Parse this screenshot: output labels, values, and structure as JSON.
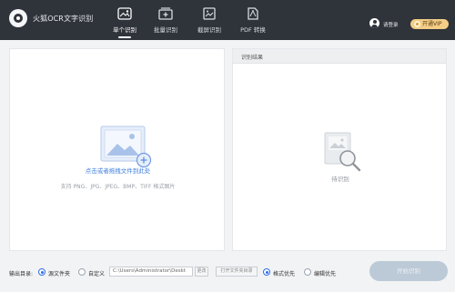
{
  "header": {
    "app_title": "火狐OCR文字识别",
    "tabs": [
      {
        "label": "单个识别",
        "icon": "image-scan-icon",
        "active": true
      },
      {
        "label": "批量识别",
        "icon": "batch-add-icon",
        "active": false
      },
      {
        "label": "截屏识别",
        "icon": "screenshot-icon",
        "active": false
      },
      {
        "label": "PDF 转换",
        "icon": "pdf-icon",
        "active": false
      }
    ],
    "login": "请登录",
    "vip_button": "开通VIP"
  },
  "upload": {
    "hint": "点击或者拖拽文件到此处",
    "formats": "支持 PNG、JPG、JPEG、BMP、TIFF 格式图片"
  },
  "result": {
    "title": "识别结果",
    "waiting": "待识别"
  },
  "bottom": {
    "output_label": "输出目录:",
    "option_source": "源文件夹",
    "option_custom": "自定义",
    "path_value": "C:\\Users\\Administrator\\Deskt",
    "change_button": "更改",
    "open_folder_button": "打开文件夹目录",
    "format_priority": "格式优先",
    "edit_priority": "编辑优先",
    "start_button": "开始识别"
  },
  "colors": {
    "header_bg": "#2f333a",
    "accent": "#2f6fe6",
    "vip": "#f3cd86",
    "start_disabled": "#bcc9d7"
  }
}
